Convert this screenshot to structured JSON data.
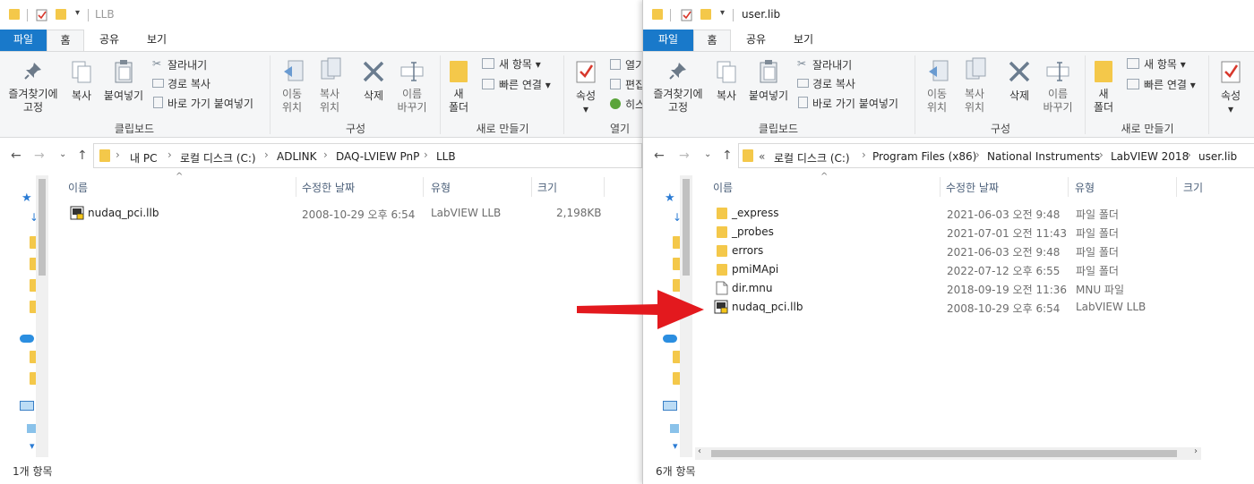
{
  "left_window": {
    "title": "LLB",
    "tabs": [
      "파일",
      "홈",
      "공유",
      "보기"
    ],
    "ribbon": {
      "pin_label": "즐겨찾기에\n고정",
      "copy_label": "복사",
      "paste_label": "붙여넣기",
      "cut_label": "잘라내기",
      "copy_path_label": "경로 복사",
      "paste_shortcut_label": "바로 가기 붙여넣기",
      "clipboard_group": "클립보드",
      "move_label": "이동\n위치",
      "copyto_label": "복사\n위치",
      "delete_label": "삭제",
      "rename_label": "이름\n바꾸기",
      "organize_group": "구성",
      "new_folder_label": "새\n폴더",
      "new_item_label": "새 항목",
      "easy_access_label": "빠른 연결",
      "new_group": "새로 만들기",
      "properties_label": "속성",
      "open_label": "열기",
      "edit_label": "편집",
      "history_label": "히스",
      "open_group": "열기"
    },
    "breadcrumb": [
      "내 PC",
      "로컬 디스크 (C:)",
      "ADLINK",
      "DAQ-LVIEW PnP",
      "LLB"
    ],
    "columns": [
      "이름",
      "수정한 날짜",
      "유형",
      "크기"
    ],
    "files": [
      {
        "name": "nudaq_pci.llb",
        "date": "2008-10-29 오후 6:54",
        "type": "LabVIEW LLB",
        "size": "2,198KB",
        "icon": "llb-icon"
      }
    ],
    "status": "1개 항목"
  },
  "right_window": {
    "title": "user.lib",
    "tabs": [
      "파일",
      "홈",
      "공유",
      "보기"
    ],
    "ribbon": {
      "pin_label": "즐겨찾기에\n고정",
      "copy_label": "복사",
      "paste_label": "붙여넣기",
      "cut_label": "잘라내기",
      "copy_path_label": "경로 복사",
      "paste_shortcut_label": "바로 가기 붙여넣기",
      "clipboard_group": "클립보드",
      "move_label": "이동\n위치",
      "copyto_label": "복사\n위치",
      "delete_label": "삭제",
      "rename_label": "이름\n바꾸기",
      "organize_group": "구성",
      "new_folder_label": "새\n폴더",
      "new_item_label": "새 항목",
      "easy_access_label": "빠른 연결",
      "new_group": "새로 만들기",
      "properties_label": "속성"
    },
    "breadcrumb_prefix": "«",
    "breadcrumb": [
      "로컬 디스크 (C:)",
      "Program Files (x86)",
      "National Instruments",
      "LabVIEW 2018",
      "user.lib"
    ],
    "columns": [
      "이름",
      "수정한 날짜",
      "유형",
      "크기"
    ],
    "files": [
      {
        "name": "_express",
        "date": "2021-06-03 오전 9:48",
        "type": "파일 폴더",
        "icon": "folder-icon"
      },
      {
        "name": "_probes",
        "date": "2021-07-01 오전 11:43",
        "type": "파일 폴더",
        "icon": "folder-icon"
      },
      {
        "name": "errors",
        "date": "2021-06-03 오전 9:48",
        "type": "파일 폴더",
        "icon": "folder-icon"
      },
      {
        "name": "pmiMApi",
        "date": "2022-07-12 오후 6:55",
        "type": "파일 폴더",
        "icon": "folder-icon"
      },
      {
        "name": "dir.mnu",
        "date": "2018-09-19 오전 11:36",
        "type": "MNU 파일",
        "icon": "file-icon"
      },
      {
        "name": "nudaq_pci.llb",
        "date": "2008-10-29 오후 6:54",
        "type": "LabVIEW LLB",
        "icon": "llb-icon"
      }
    ],
    "status": "6개 항목"
  },
  "colors": {
    "file_tab": "#1979ca",
    "arrow": "#e3191e",
    "folder": "#f4c84a"
  }
}
